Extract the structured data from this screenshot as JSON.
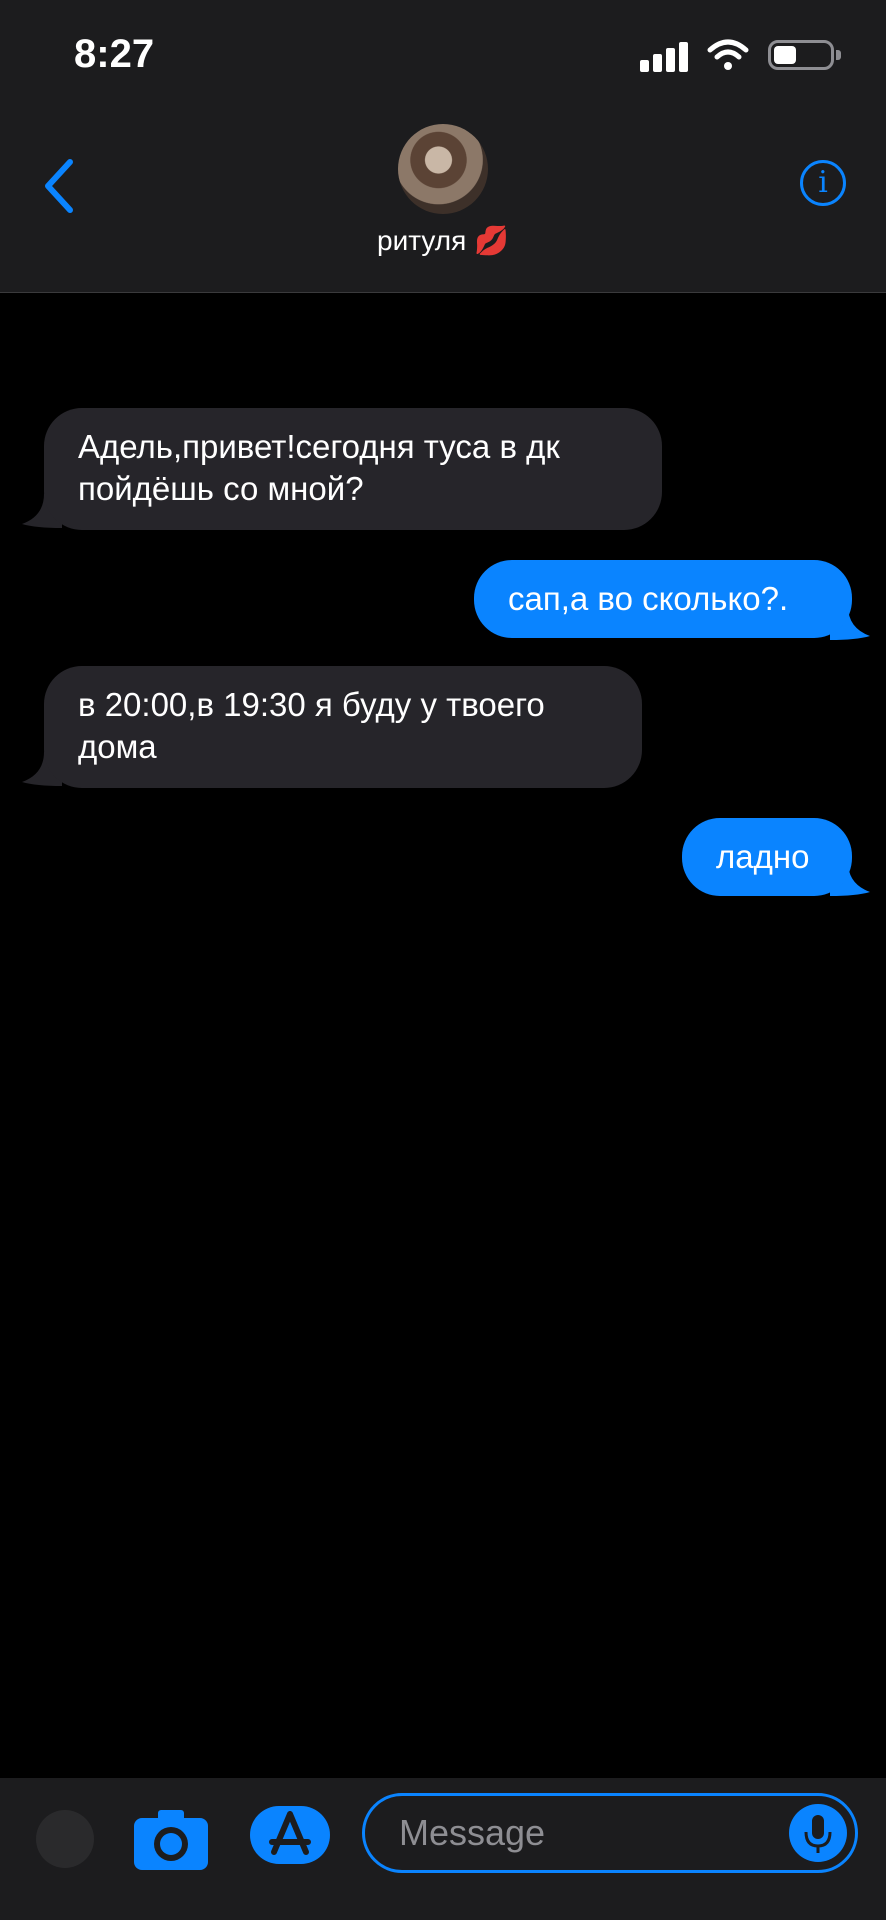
{
  "status_bar": {
    "time": "8:27"
  },
  "header": {
    "contact_name": "ритуля 💋"
  },
  "messages": [
    {
      "direction": "incoming",
      "lines": [
        "Адель,привет!сегодня туса в дк",
        "пойдёшь со мной?"
      ]
    },
    {
      "direction": "outgoing",
      "lines": [
        "сап,а во сколько?."
      ]
    },
    {
      "direction": "incoming",
      "lines": [
        "в 20:00,в 19:30 я буду у твоего",
        "дома"
      ]
    },
    {
      "direction": "outgoing",
      "lines": [
        "ладно"
      ]
    }
  ],
  "composer": {
    "placeholder": "Message"
  },
  "colors": {
    "accent": "#0a84ff",
    "incoming_bubble": "#26252a",
    "header_bg": "#1c1c1e"
  }
}
